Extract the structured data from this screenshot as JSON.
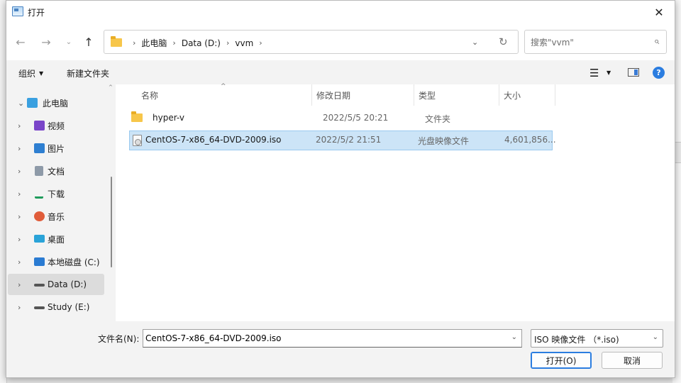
{
  "window": {
    "title": "打开",
    "close_glyph": "✕"
  },
  "nav": {
    "back_glyph": "←",
    "forward_glyph": "→",
    "recent_glyph": "⌄",
    "up_glyph": "↑",
    "breadcrumbs": [
      "此电脑",
      "Data (D:)",
      "vvm"
    ],
    "crumb_sep": "›",
    "dropdown_glyph": "⌄",
    "refresh_glyph": "↻",
    "search_placeholder": "搜索\"vvm\"",
    "search_glyph": "⌕"
  },
  "commands": {
    "organize_label": "组织",
    "organize_caret": "▼",
    "newfolder_label": "新建文件夹",
    "view_glyph": "☰",
    "view_caret": "▼",
    "help_glyph": "?"
  },
  "tree": {
    "collapse_glyph": "⌄",
    "expand_glyph": "›",
    "sort_caret": "^",
    "items": [
      {
        "label": "此电脑",
        "icon": "pc-icon",
        "color": "#3aa0e0"
      },
      {
        "label": "视频",
        "icon": "video-icon",
        "color": "#7a45c9"
      },
      {
        "label": "图片",
        "icon": "pictures-icon",
        "color": "#2e7fd1"
      },
      {
        "label": "文档",
        "icon": "documents-icon",
        "color": "#8e9aa8"
      },
      {
        "label": "下载",
        "icon": "download-icon",
        "color": "#1f9b5b"
      },
      {
        "label": "音乐",
        "icon": "music-icon",
        "color": "#e05c3a"
      },
      {
        "label": "桌面",
        "icon": "desktop-icon",
        "color": "#2aa3d8"
      },
      {
        "label": "本地磁盘 (C:)",
        "icon": "drive-c-icon",
        "color": "#2a7bd2"
      },
      {
        "label": "Data (D:)",
        "icon": "drive-d-icon",
        "color": "#555555"
      },
      {
        "label": "Study (E:)",
        "icon": "drive-e-icon",
        "color": "#555555"
      }
    ]
  },
  "columns": [
    "名称",
    "修改日期",
    "类型",
    "大小"
  ],
  "files": [
    {
      "name": "hyper-v",
      "date": "2022/5/5 20:21",
      "type": "文件夹",
      "size": ""
    },
    {
      "name": "CentOS-7-x86_64-DVD-2009.iso",
      "date": "2022/5/2 21:51",
      "type": "光盘映像文件",
      "size": "4,601,856..."
    }
  ],
  "bottom": {
    "filename_label": "文件名(N):",
    "filename_value": "CentOS-7-x86_64-DVD-2009.iso",
    "filetype_value": "ISO 映像文件 （*.iso)",
    "dropdown_glyph": "⌄",
    "open_label": "打开(O)",
    "cancel_label": "取消"
  },
  "colors": {
    "accent": "#2b7de0",
    "selection": "#cce4f7",
    "folder": "#f7c64a"
  }
}
